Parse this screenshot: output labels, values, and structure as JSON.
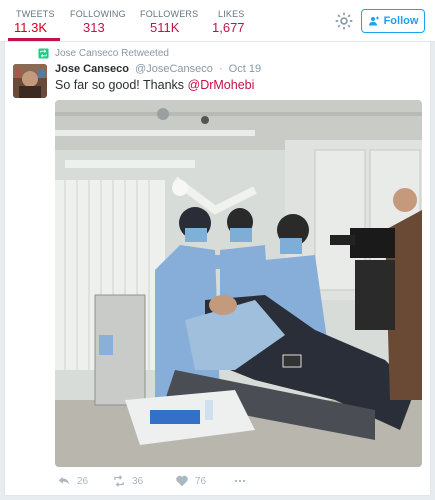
{
  "stats": [
    {
      "label": "TWEETS",
      "value": "11.3K"
    },
    {
      "label": "FOLLOWING",
      "value": "313"
    },
    {
      "label": "FOLLOWERS",
      "value": "511K"
    },
    {
      "label": "LIKES",
      "value": "1,677"
    }
  ],
  "header": {
    "follow_label": "Follow",
    "icons": [
      "gear-icon",
      "add-person-icon"
    ],
    "accent_color": "#c0134a",
    "link_color": "#1da1f2"
  },
  "tweet": {
    "retweet_context": "Jose Canseco Retweeted",
    "author_name": "Jose Canseco",
    "author_handle": "@JoseCanseco",
    "separator": "·",
    "date": "Oct 19",
    "text": "So far so good! Thanks ",
    "mention": "@DrMohebi",
    "photo_description_icon": "dental-procedure-photo"
  },
  "actions": {
    "reply_count": "26",
    "retweet_count": "36",
    "like_count": "76"
  }
}
